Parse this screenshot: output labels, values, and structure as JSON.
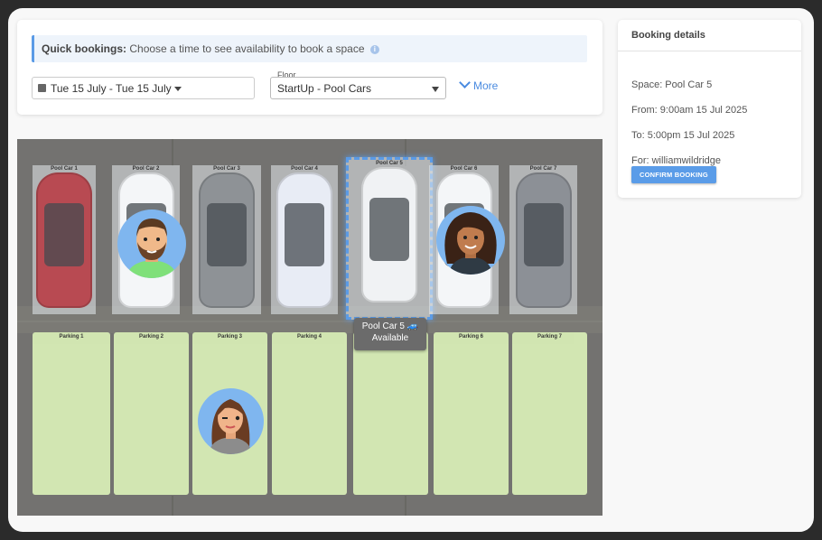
{
  "quick_bookings": {
    "title": "Quick bookings:",
    "text": "Choose a time to see availability to book a space",
    "date_range": "Tue 15 July - Tue 15 July",
    "floor_label": "Floor",
    "floor_value": "StartUp - Pool Cars",
    "more_label": "More"
  },
  "booking_details": {
    "title": "Booking details",
    "space": "Space: Pool Car 5",
    "from": "From: 9:00am 15 Jul 2025",
    "to": "To: 5:00pm 15 Jul 2025",
    "for": "For: williamwildridge",
    "confirm_label": "CONFIRM BOOKING"
  },
  "map": {
    "pool_cars": [
      "Pool Car 1",
      "Pool Car 2",
      "Pool Car 3",
      "Pool Car 4",
      "Pool Car 5",
      "Pool Car 6",
      "Pool Car 7"
    ],
    "parking": [
      "Parking 1",
      "Parking 2",
      "Parking 3",
      "Parking 4",
      "Parking 5",
      "Parking 6",
      "Parking 7"
    ],
    "tooltip": {
      "title": "Pool Car 5",
      "status": "Available"
    },
    "colors": {
      "selected": "#5b9be6",
      "available_spot": "#d7ecb5",
      "pool_spot": "#e8ecef",
      "tooltip": "#6b6b6b"
    }
  }
}
